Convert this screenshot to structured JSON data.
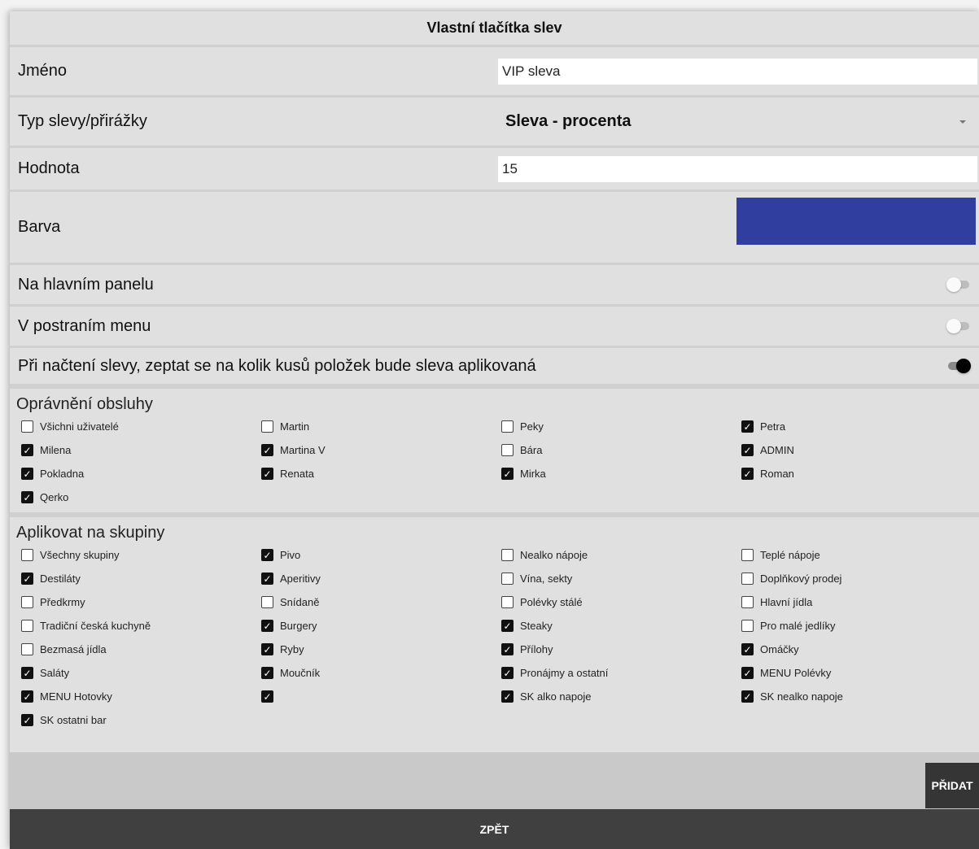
{
  "dialog": {
    "title": "Vlastní tlačítka slev"
  },
  "fields": {
    "name": {
      "label": "Jméno",
      "value": "VIP sleva"
    },
    "type": {
      "label": "Typ slevy/přirážky",
      "value": "Sleva - procenta"
    },
    "value": {
      "label": "Hodnota",
      "value": "15"
    },
    "color": {
      "label": "Barva",
      "hex": "#303f9f"
    },
    "main_panel": {
      "label": "Na hlavním panelu",
      "on": false
    },
    "side_menu": {
      "label": "V postraním menu",
      "on": false
    },
    "ask_quantity": {
      "label": "Při načtení slevy, zeptat se na kolik kusů položek bude sleva aplikovaná",
      "on": true
    }
  },
  "permissions": {
    "title": "Oprávnění obsluhy",
    "items": [
      {
        "label": "Všichni uživatelé",
        "checked": false
      },
      {
        "label": "Martin",
        "checked": false
      },
      {
        "label": "Peky",
        "checked": false
      },
      {
        "label": "Petra",
        "checked": true
      },
      {
        "label": "Milena",
        "checked": true
      },
      {
        "label": "Martina V",
        "checked": true
      },
      {
        "label": "Bára",
        "checked": false
      },
      {
        "label": "ADMIN",
        "checked": true
      },
      {
        "label": "Pokladna",
        "checked": true
      },
      {
        "label": "Renata",
        "checked": true
      },
      {
        "label": "Mirka",
        "checked": true
      },
      {
        "label": "Roman",
        "checked": true
      },
      {
        "label": "Qerko",
        "checked": true
      }
    ]
  },
  "groups": {
    "title": "Aplikovat na skupiny",
    "items": [
      {
        "label": "Všechny skupiny",
        "checked": false
      },
      {
        "label": "Pivo",
        "checked": true
      },
      {
        "label": "Nealko nápoje",
        "checked": false
      },
      {
        "label": "Teplé nápoje",
        "checked": false
      },
      {
        "label": "Destiláty",
        "checked": true
      },
      {
        "label": "Aperitivy",
        "checked": true
      },
      {
        "label": "Vína, sekty",
        "checked": false
      },
      {
        "label": "Doplňkový prodej",
        "checked": false
      },
      {
        "label": "Předkrmy",
        "checked": false
      },
      {
        "label": "Snídaně",
        "checked": false
      },
      {
        "label": "Polévky stálé",
        "checked": false
      },
      {
        "label": "Hlavní jídla",
        "checked": false
      },
      {
        "label": "Tradiční česká kuchyně",
        "checked": false
      },
      {
        "label": "Burgery",
        "checked": true
      },
      {
        "label": "Steaky",
        "checked": true
      },
      {
        "label": "Pro malé jedlíky",
        "checked": false
      },
      {
        "label": "Bezmasá jídla",
        "checked": false
      },
      {
        "label": "Ryby",
        "checked": true
      },
      {
        "label": "Přílohy",
        "checked": true
      },
      {
        "label": "Omáčky",
        "checked": true
      },
      {
        "label": "Saláty",
        "checked": true
      },
      {
        "label": "Moučník",
        "checked": true
      },
      {
        "label": "Pronájmy a ostatní",
        "checked": true
      },
      {
        "label": "MENU Polévky",
        "checked": true
      },
      {
        "label": "MENU Hotovky",
        "checked": true
      },
      {
        "label": "",
        "checked": true
      },
      {
        "label": "SK alko napoje",
        "checked": true
      },
      {
        "label": "SK nealko napoje",
        "checked": true
      },
      {
        "label": "SK ostatni bar",
        "checked": true
      }
    ]
  },
  "buttons": {
    "add": "PŘIDAT",
    "back": "ZPĚT"
  }
}
